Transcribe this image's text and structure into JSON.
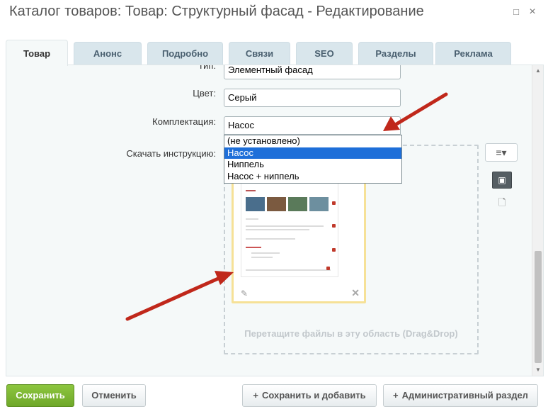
{
  "window": {
    "title": "Каталог товаров: Товар: Структурный фасад - Редактирование",
    "minimize_glyph": "□",
    "close_glyph": "×"
  },
  "tabs": [
    {
      "label": "Товар",
      "active": true
    },
    {
      "label": "Анонс"
    },
    {
      "label": "Подробно"
    },
    {
      "label": "Связи"
    },
    {
      "label": "SEO"
    },
    {
      "label": "Разделы"
    },
    {
      "label": "Реклама"
    }
  ],
  "form": {
    "type": {
      "label": "Тип:",
      "value": "Элементный фасад"
    },
    "color": {
      "label": "Цвет:",
      "value": "Серый"
    },
    "kit": {
      "label": "Комплектация:",
      "value": "Насос",
      "options": [
        "(не установлено)",
        "Насос",
        "Ниппель",
        "Насос + ниппель"
      ],
      "selected_index": 1
    },
    "download": {
      "label": "Скачать инструкцию:",
      "dropzone_hint": "Перетащите файлы в эту область (Drag&Drop)"
    }
  },
  "icons": {
    "menu": "≡▾",
    "image": "▣",
    "file": "🗋",
    "pencil": "✎",
    "remove": "✕"
  },
  "annotation_color": "#c0281b",
  "footer": {
    "save": "Сохранить",
    "cancel": "Отменить",
    "save_add": "Сохранить и добавить",
    "admin": "Административный раздел",
    "plus_glyph": "+"
  }
}
